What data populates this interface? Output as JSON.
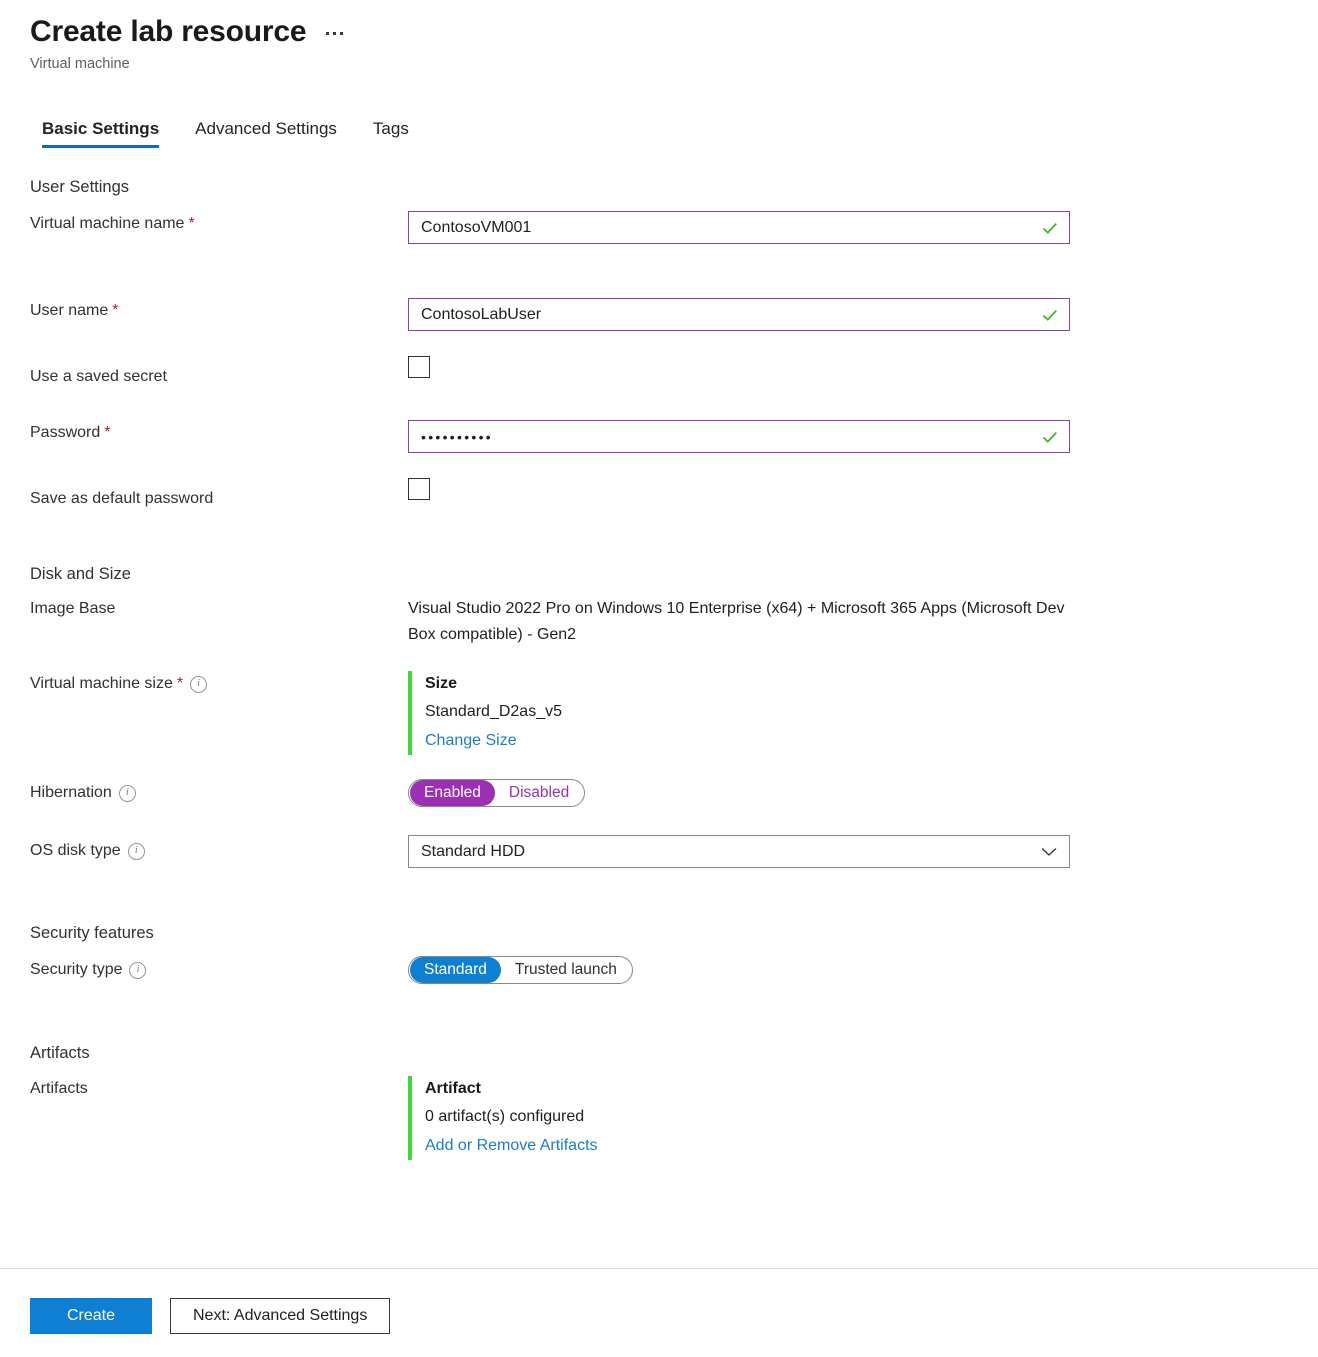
{
  "header": {
    "title": "Create lab resource",
    "subtitle": "Virtual machine",
    "more_menu": "more-options"
  },
  "tabs": [
    {
      "label": "Basic Settings",
      "active": true
    },
    {
      "label": "Advanced Settings",
      "active": false
    },
    {
      "label": "Tags",
      "active": false
    }
  ],
  "sections": {
    "user_settings": {
      "heading": "User Settings",
      "vm_name": {
        "label": "Virtual machine name",
        "required": "*",
        "value": "ContosoVM001",
        "validated": true
      },
      "user_name": {
        "label": "User name",
        "required": "*",
        "value": "ContosoLabUser",
        "validated": true
      },
      "saved_secret": {
        "label": "Use a saved secret",
        "checked": false
      },
      "password": {
        "label": "Password",
        "required": "*",
        "value": "••••••••••",
        "validated": true
      },
      "default_password": {
        "label": "Save as default password",
        "checked": false
      }
    },
    "disk_and_size": {
      "heading": "Disk and Size",
      "image_base": {
        "label": "Image Base",
        "value": "Visual Studio 2022 Pro on Windows 10 Enterprise (x64) + Microsoft 365 Apps (Microsoft Dev Box compatible) - Gen2"
      },
      "vm_size": {
        "label": "Virtual machine size",
        "required": "*",
        "card_title": "Size",
        "card_value": "Standard_D2as_v5",
        "link": "Change Size"
      },
      "hibernation": {
        "label": "Hibernation",
        "options": [
          "Enabled",
          "Disabled"
        ],
        "selected": "Enabled"
      },
      "os_disk_type": {
        "label": "OS disk type",
        "value": "Standard HDD"
      }
    },
    "security_features": {
      "heading": "Security features",
      "security_type": {
        "label": "Security type",
        "options": [
          "Standard",
          "Trusted launch"
        ],
        "selected": "Standard"
      }
    },
    "artifacts": {
      "heading": "Artifacts",
      "label": "Artifacts",
      "card_title": "Artifact",
      "card_value": "0 artifact(s) configured",
      "link": "Add or Remove Artifacts"
    }
  },
  "footer": {
    "create_label": "Create",
    "next_label": "Next: Advanced Settings"
  },
  "colors": {
    "accent_blue": "#0f7fd4",
    "tab_underline": "#0f6cbd",
    "field_border_purple": "#8c3f9e",
    "validation_green": "#4caf28",
    "card_accent_green": "#3fd63f",
    "toggle_purple": "#9b30b5",
    "required_red": "#a4262c",
    "link_blue": "#1a7bd1"
  }
}
